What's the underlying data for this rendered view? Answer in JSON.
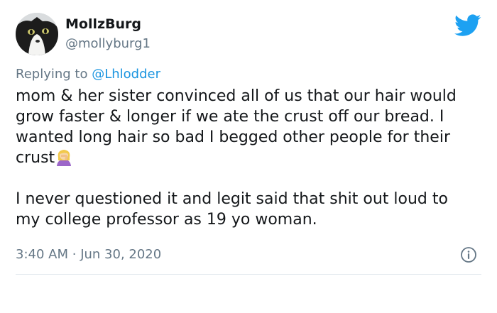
{
  "user": {
    "display_name": "MollzBurg",
    "handle": "@mollyburg1",
    "avatar_icon": "cat-avatar"
  },
  "reply": {
    "prefix": "Replying to",
    "mention": "@Lhlodder"
  },
  "tweet": {
    "paragraph_1": "mom & her sister convinced all of us that our hair would grow faster & longer if we ate the crust off our bread.  I wanted long hair so bad I begged other people for their crust",
    "emoji": "woman-facepalming-emoji",
    "paragraph_2": "I never questioned it and legit said that shit out loud to my college professor as 19 yo woman."
  },
  "meta": {
    "time": "3:40 AM",
    "separator": "·",
    "date": "Jun 30, 2020"
  },
  "icons": {
    "brand": "twitter-bird-icon",
    "info": "info-icon"
  },
  "colors": {
    "brand_blue": "#1da1f2",
    "mention_blue": "#1b95e0",
    "secondary_text": "#657786",
    "primary_text": "#14171a"
  }
}
